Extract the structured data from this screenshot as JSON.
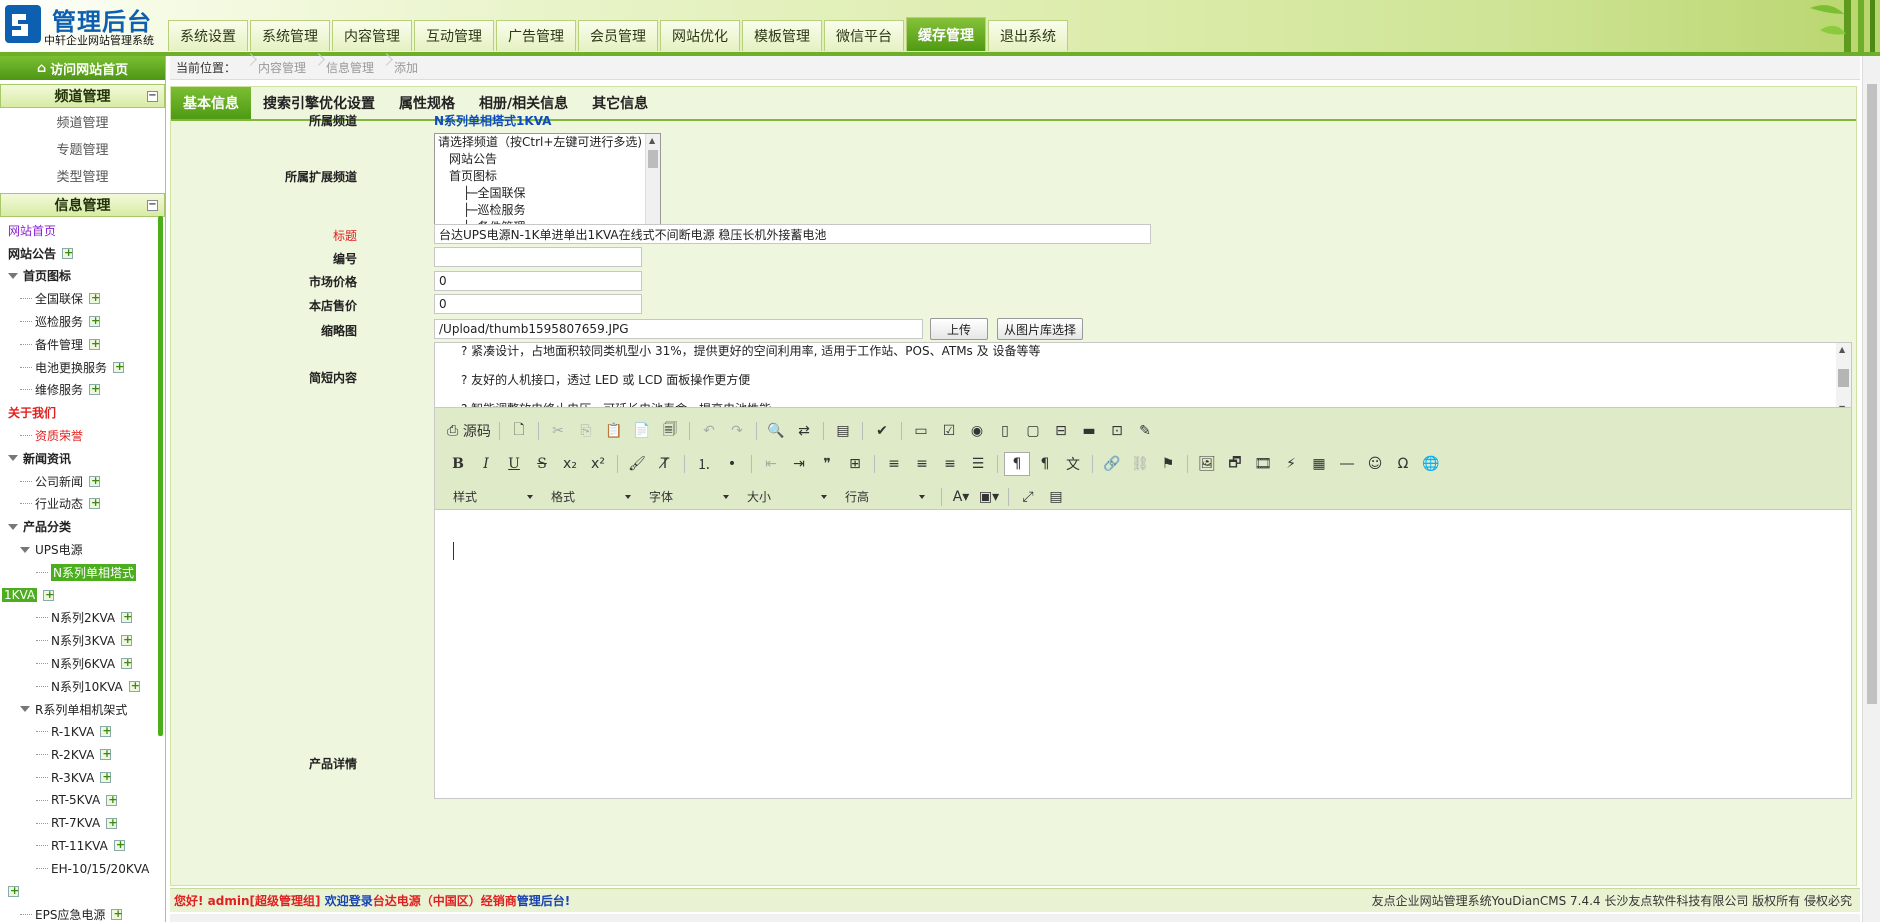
{
  "brand": {
    "title": "管理后台",
    "subtitle": "中轩企业网站管理系统"
  },
  "topnav": [
    "系统设置",
    "系统管理",
    "内容管理",
    "互动管理",
    "广告管理",
    "会员管理",
    "网站优化",
    "模板管理",
    "微信平台",
    "缓存管理",
    "退出系统"
  ],
  "topnav_active": "缓存管理",
  "sidebar": {
    "home_link": "访问网站首页",
    "channel_section": {
      "title": "频道管理",
      "items": [
        "频道管理",
        "专题管理",
        "类型管理"
      ]
    },
    "info_section": {
      "title": "信息管理"
    },
    "tree": [
      {
        "label": "网站首页",
        "level": 0,
        "style": "purple",
        "plus": false,
        "tri": false
      },
      {
        "label": "网站公告",
        "level": 0,
        "style": "bold",
        "plus": true,
        "tri": false
      },
      {
        "label": "首页图标",
        "level": 0,
        "style": "bold",
        "plus": false,
        "tri": true
      },
      {
        "label": "全国联保",
        "level": 1,
        "style": "",
        "plus": true,
        "tri": false
      },
      {
        "label": "巡检服务",
        "level": 1,
        "style": "",
        "plus": true,
        "tri": false
      },
      {
        "label": "备件管理",
        "level": 1,
        "style": "",
        "plus": true,
        "tri": false
      },
      {
        "label": "电池更换服务",
        "level": 1,
        "style": "",
        "plus": true,
        "tri": false
      },
      {
        "label": "维修服务",
        "level": 1,
        "style": "",
        "plus": true,
        "tri": false
      },
      {
        "label": "关于我们",
        "level": 0,
        "style": "bold red",
        "plus": false,
        "tri": false
      },
      {
        "label": "资质荣誉",
        "level": 1,
        "style": "red",
        "plus": false,
        "tri": false
      },
      {
        "label": "新闻资讯",
        "level": 0,
        "style": "bold",
        "plus": false,
        "tri": true
      },
      {
        "label": "公司新闻",
        "level": 1,
        "style": "",
        "plus": true,
        "tri": false
      },
      {
        "label": "行业动态",
        "level": 1,
        "style": "",
        "plus": true,
        "tri": false
      },
      {
        "label": "产品分类",
        "level": 0,
        "style": "bold",
        "plus": false,
        "tri": true
      },
      {
        "label": "UPS电源",
        "level": 1,
        "style": "",
        "plus": false,
        "tri": true
      },
      {
        "label": "N系列单相塔式",
        "level": 3,
        "style": "sel",
        "plus": false,
        "tri": false
      },
      {
        "label": "1KVA",
        "level": -1,
        "style": "sel",
        "plus": true,
        "tri": false
      },
      {
        "label": "N系列2KVA",
        "level": 3,
        "style": "",
        "plus": true,
        "tri": false
      },
      {
        "label": "N系列3KVA",
        "level": 3,
        "style": "",
        "plus": true,
        "tri": false
      },
      {
        "label": "N系列6KVA",
        "level": 3,
        "style": "",
        "plus": true,
        "tri": false
      },
      {
        "label": "N系列10KVA",
        "level": 3,
        "style": "",
        "plus": true,
        "tri": false
      },
      {
        "label": "R系列单相机架式",
        "level": 1,
        "style": "",
        "plus": false,
        "tri": true
      },
      {
        "label": "R-1KVA",
        "level": 3,
        "style": "",
        "plus": true,
        "tri": false
      },
      {
        "label": "R-2KVA",
        "level": 3,
        "style": "",
        "plus": true,
        "tri": false
      },
      {
        "label": "R-3KVA",
        "level": 3,
        "style": "",
        "plus": true,
        "tri": false
      },
      {
        "label": "RT-5KVA",
        "level": 3,
        "style": "",
        "plus": true,
        "tri": false
      },
      {
        "label": "RT-7KVA",
        "level": 3,
        "style": "",
        "plus": true,
        "tri": false
      },
      {
        "label": "RT-11KVA",
        "level": 3,
        "style": "",
        "plus": true,
        "tri": false
      },
      {
        "label": "EH-10/15/20KVA",
        "level": 3,
        "style": "",
        "plus": false,
        "tri": false
      },
      {
        "label": "",
        "level": -1,
        "style": "",
        "plus": true,
        "tri": false
      },
      {
        "label": "EPS应急电源",
        "level": 1,
        "style": "",
        "plus": true,
        "tri": false
      }
    ]
  },
  "breadcrumb": {
    "here": "当前位置：",
    "items": [
      "内容管理",
      "信息管理",
      "添加"
    ]
  },
  "tabs": [
    "基本信息",
    "搜索引擎优化设置",
    "属性规格",
    "相册/相关信息",
    "其它信息"
  ],
  "form": {
    "channel_label": "所属频道",
    "channel_value": "N系列单相塔式1KVA",
    "ext_channel_label": "所属扩展频道",
    "ext_channel_options": [
      "请选择频道（按Ctrl+左键可进行多选)",
      "网站公告",
      "首页图标",
      "├─全国联保",
      "├─巡检服务",
      "├─备件管理"
    ],
    "title_label": "标题",
    "title_value": "台达UPS电源N-1K单进单出1KVA在线式不间断电源 稳压长机外接蓄电池",
    "code_label": "编号",
    "code_value": "",
    "market_price_label": "市场价格",
    "market_price_value": "0",
    "store_price_label": "本店售价",
    "store_price_value": "0",
    "thumb_label": "缩略图",
    "thumb_value": "/Upload/thumb1595807659.JPG",
    "upload_button": "上传",
    "library_button": "从图片库选择",
    "summary_label": "简短内容",
    "summary_lines": [
      "? 紧凑设计，占地面积较同类机型小 31%，提供更好的空间利用率, 适用于工作站、POS、ATMs 及 设备等等",
      "? 友好的人机接口，透过 LED 或 LCD 面板操作更方便",
      "? 智能调整放电终止电压，可延长电池寿命，提高电池性能"
    ],
    "detail_label": "产品详情"
  },
  "editor": {
    "source_label": "源码",
    "dropdowns": [
      "样式",
      "格式",
      "字体",
      "大小",
      "行高"
    ]
  },
  "footer": {
    "hello": "您好!",
    "user": "admin[超级管理组]",
    "welcome_pre": "欢迎登录",
    "site": "台达电源（中国区）经销商",
    "welcome_post": "管理后台!",
    "right": "友点企业网站管理系统YouDianCMS 7.4.4  长沙友点软件科技有限公司 版权所有 侵权必究"
  }
}
